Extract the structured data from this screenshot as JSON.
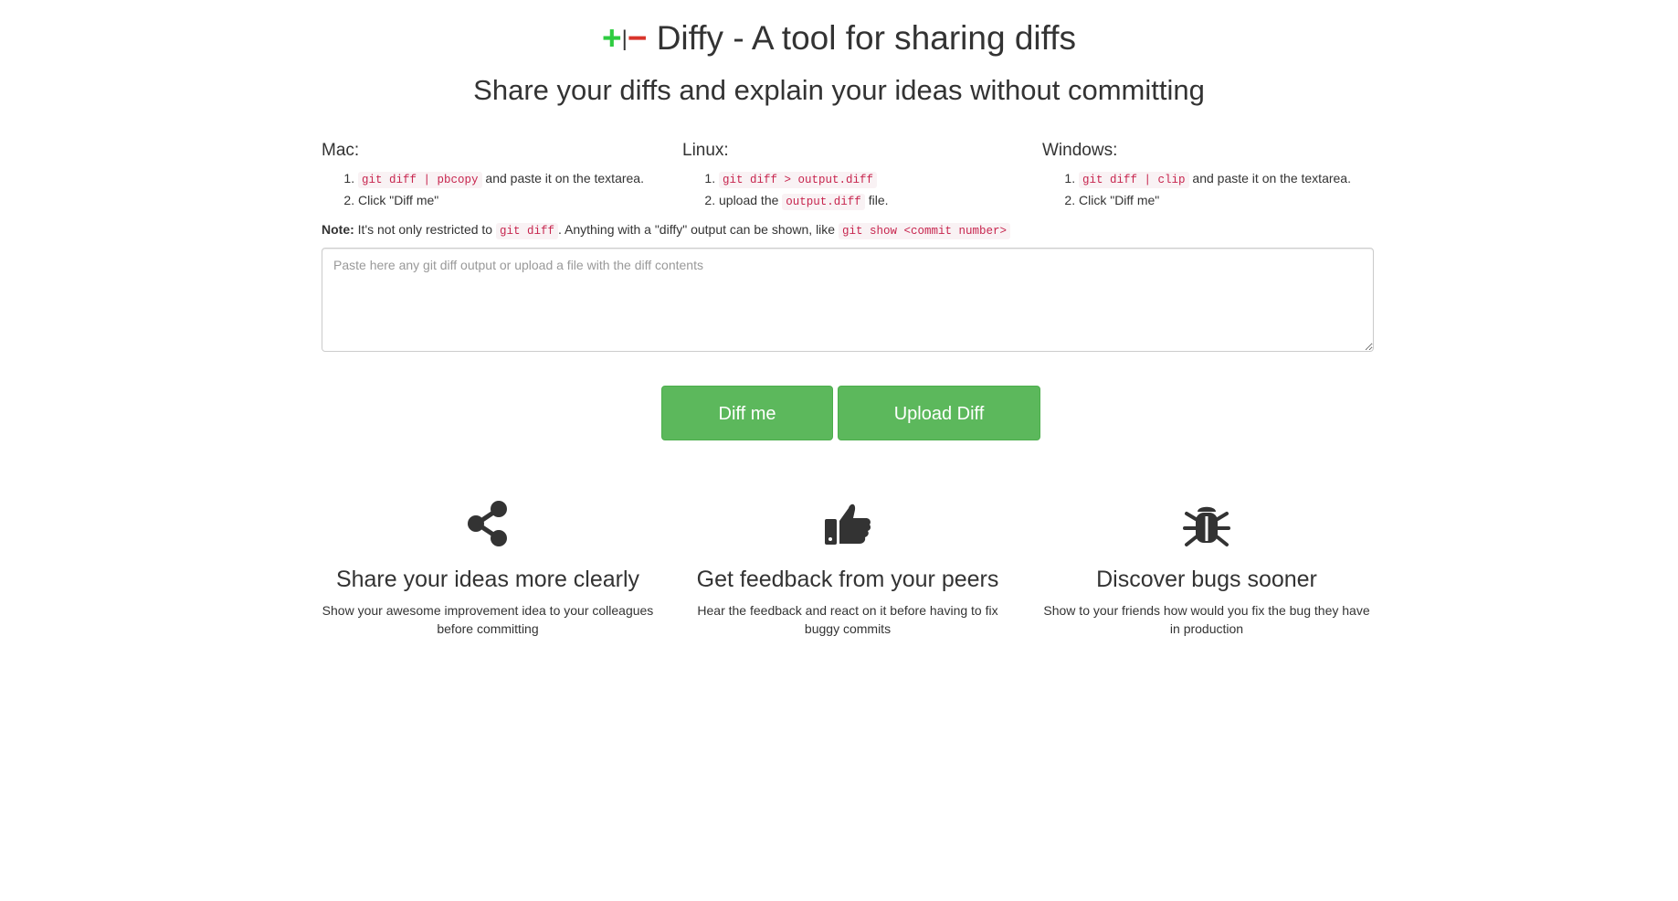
{
  "header": {
    "logo_plus": "+",
    "logo_bar": "|",
    "logo_minus": "−",
    "title": "Diffy - A tool for sharing diffs",
    "subtitle": "Share your diffs and explain your ideas without committing"
  },
  "instructions": {
    "mac": {
      "heading": "Mac:",
      "step1_code": "git diff | pbcopy",
      "step1_text": "and paste it on the textarea.",
      "step2": "Click \"Diff me\""
    },
    "linux": {
      "heading": "Linux:",
      "step1_code": "git diff > output.diff",
      "step2_prefix": "upload the",
      "step2_code": "output.diff",
      "step2_suffix": "file."
    },
    "windows": {
      "heading": "Windows:",
      "step1_code": "git diff | clip",
      "step1_text": "and paste it on the textarea.",
      "step2": "Click \"Diff me\""
    }
  },
  "note": {
    "label": "Note:",
    "text1": "It's not only restricted to",
    "code1": "git diff",
    "text2": ". Anything with a \"diffy\" output can be shown, like",
    "code2": "git show <commit number>"
  },
  "diff_input": {
    "placeholder": "Paste here any git diff output or upload a file with the diff contents",
    "value": ""
  },
  "actions": {
    "diff_me": "Diff me",
    "upload_diff": "Upload Diff"
  },
  "features": [
    {
      "icon": "share-icon",
      "title": "Share your ideas more clearly",
      "description": "Show your awesome improvement idea to your colleagues before committing"
    },
    {
      "icon": "thumbs-up-icon",
      "title": "Get feedback from your peers",
      "description": "Hear the feedback and react on it before having to fix buggy commits"
    },
    {
      "icon": "bug-icon",
      "title": "Discover bugs sooner",
      "description": "Show to your friends how would you fix the bug they have in production"
    }
  ],
  "colors": {
    "plus_green": "#2ecc40",
    "minus_red": "#d9342b",
    "button_green": "#5cb85c",
    "code_red": "#c7254e"
  }
}
